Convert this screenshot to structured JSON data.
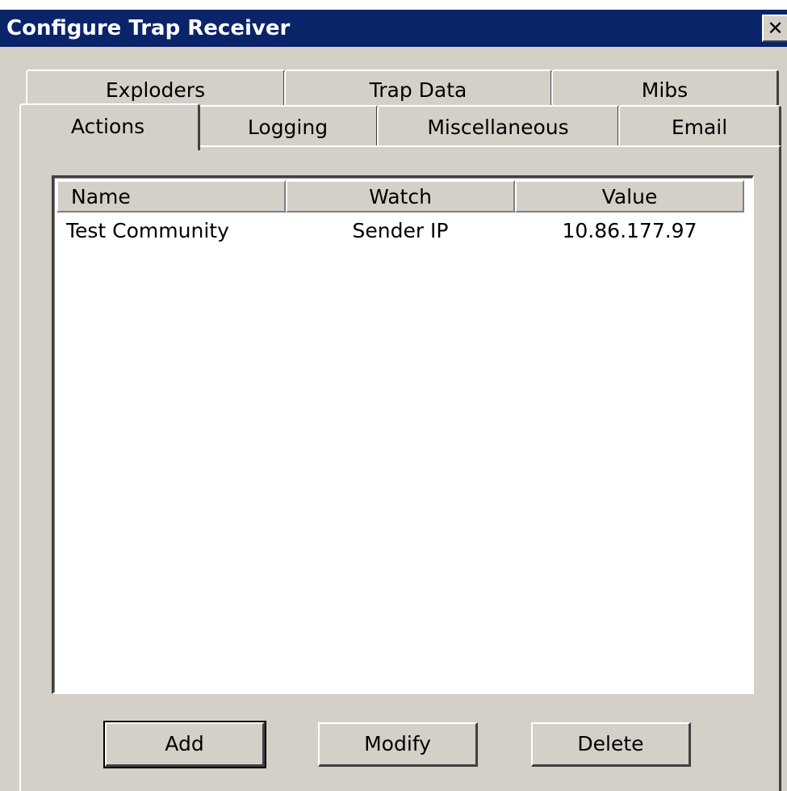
{
  "window": {
    "title": "Configure Trap Receiver",
    "close_glyph": "✕",
    "titlebar_color": "#0a246a",
    "face_color": "#d4d0c8"
  },
  "tabs": {
    "row1": [
      {
        "label": "Exploders"
      },
      {
        "label": "Trap Data"
      },
      {
        "label": "Mibs"
      }
    ],
    "row2": [
      {
        "label": "Actions",
        "selected": true
      },
      {
        "label": "Logging"
      },
      {
        "label": "Miscellaneous"
      },
      {
        "label": "Email"
      }
    ]
  },
  "list": {
    "columns": [
      "Name",
      "Watch",
      "Value"
    ],
    "rows": [
      {
        "name": "Test Community",
        "watch": "Sender IP",
        "value": "10.86.177.97"
      }
    ]
  },
  "buttons": {
    "add": "Add",
    "modify": "Modify",
    "delete": "Delete"
  }
}
